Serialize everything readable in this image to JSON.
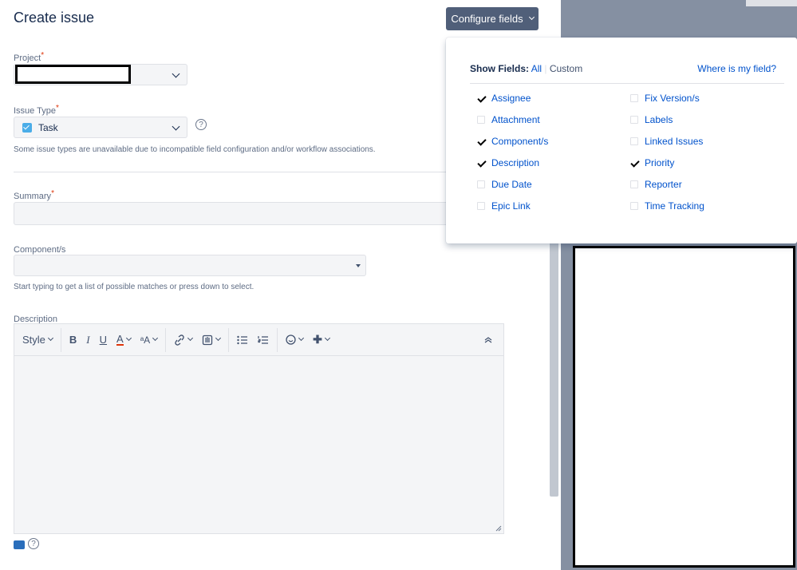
{
  "header": {
    "title": "Create issue",
    "configure_label": "Configure fields"
  },
  "form": {
    "project_label": "Project",
    "issue_type_label": "Issue Type",
    "issue_type_value": "Task",
    "issue_type_hint": "Some issue types are unavailable due to incompatible field configuration and/or workflow associations.",
    "summary_label": "Summary",
    "components_label": "Component/s",
    "components_hint": "Start typing to get a list of possible matches or press down to select.",
    "description_label": "Description",
    "required_mark": "*"
  },
  "toolbar": {
    "style_label": "Style",
    "bold": "B",
    "italic": "I",
    "underline": "U",
    "color": "A",
    "font_size": "ᵃA",
    "plus": "✚"
  },
  "popup": {
    "show_label": "Show Fields:",
    "all_label": "All",
    "custom_label": "Custom",
    "where_label": "Where is my field?",
    "left_fields": [
      {
        "label": "Assignee",
        "checked": true
      },
      {
        "label": "Attachment",
        "checked": false
      },
      {
        "label": "Component/s",
        "checked": true
      },
      {
        "label": "Description",
        "checked": true
      },
      {
        "label": "Due Date",
        "checked": false
      },
      {
        "label": "Epic Link",
        "checked": false
      }
    ],
    "right_fields": [
      {
        "label": "Fix Version/s",
        "checked": false
      },
      {
        "label": "Labels",
        "checked": false
      },
      {
        "label": "Linked Issues",
        "checked": false
      },
      {
        "label": "Priority",
        "checked": true
      },
      {
        "label": "Reporter",
        "checked": false
      },
      {
        "label": "Time Tracking",
        "checked": false
      }
    ]
  },
  "colors": {
    "accent": "#0052cc",
    "button_bg": "#505f79",
    "required": "#de350b",
    "task_icon": "#4bade8"
  }
}
